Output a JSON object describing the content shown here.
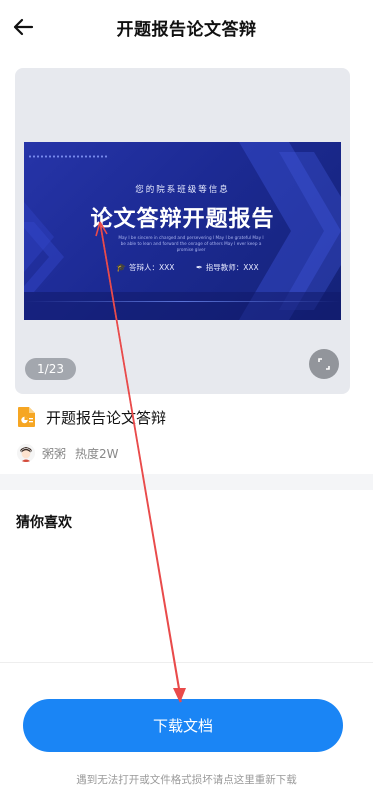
{
  "header": {
    "title": "开题报告论文答辩",
    "back_icon": "arrow-left-icon"
  },
  "preview": {
    "slide": {
      "subtitle": "您的院系班级等信息",
      "main_title": "论文答辩开题报告",
      "english_text": "May I be sincere in charged and persevering I May I be grateful May I be able to lean and forward the onrage of others May I ever keep a promise giver",
      "presenter": "答辩人：XXX",
      "advisor": "指导教师：XXX"
    },
    "page_indicator": "1/23",
    "fullscreen_icon": "expand-icon"
  },
  "document": {
    "title": "开题报告论文答辩",
    "file_icon": "ppt-file-icon",
    "author": "粥粥",
    "heat": "热度2W"
  },
  "recommend": {
    "title": "猜你喜欢"
  },
  "actions": {
    "download_label": "下载文档",
    "hint": "遇到无法打开或文件格式损坏请点这里重新下载"
  },
  "colors": {
    "accent": "#1a85f5",
    "slide_bg": "#1c2a93",
    "annotation_arrow": "#e94b4b"
  }
}
